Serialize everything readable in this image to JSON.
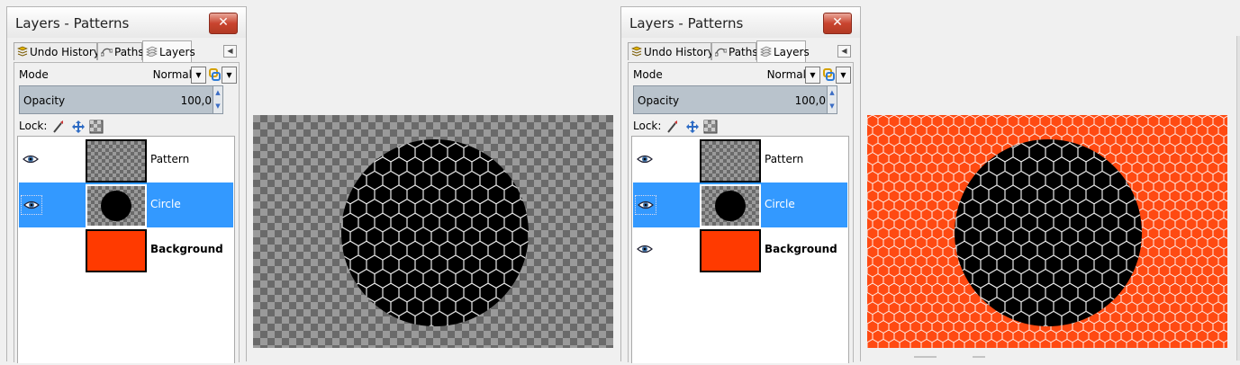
{
  "left_dock": {
    "title": "Layers - Patterns",
    "tabs": [
      {
        "label": "Undo History",
        "icon": "undo-history-icon"
      },
      {
        "label": "Paths",
        "icon": "paths-icon"
      },
      {
        "label": "Layers",
        "icon": "layers-icon",
        "active": true
      }
    ],
    "mode_label": "Mode",
    "mode_value": "Normal",
    "opacity_label": "Opacity",
    "opacity_value": "100,0",
    "lock_label": "Lock:",
    "layers": [
      {
        "name": "Pattern",
        "visible": true,
        "selected": false
      },
      {
        "name": "Circle",
        "visible": true,
        "selected": true
      },
      {
        "name": "Background",
        "visible": false,
        "selected": false
      }
    ]
  },
  "right_dock": {
    "title": "Layers - Patterns",
    "tabs": [
      {
        "label": "Undo History",
        "icon": "undo-history-icon"
      },
      {
        "label": "Paths",
        "icon": "paths-icon"
      },
      {
        "label": "Layers",
        "icon": "layers-icon",
        "active": true
      }
    ],
    "mode_label": "Mode",
    "mode_value": "Normal",
    "opacity_label": "Opacity",
    "opacity_value": "100,0",
    "lock_label": "Lock:",
    "layers": [
      {
        "name": "Pattern",
        "visible": true,
        "selected": false
      },
      {
        "name": "Circle",
        "visible": true,
        "selected": true
      },
      {
        "name": "Background",
        "visible": true,
        "selected": false
      }
    ]
  },
  "colors": {
    "selection": "#3399ff",
    "background_layer": "#ff3a00",
    "canvas_orange": "#ff4a12",
    "circle": "#000000",
    "hex_stroke": "#ffffff"
  }
}
